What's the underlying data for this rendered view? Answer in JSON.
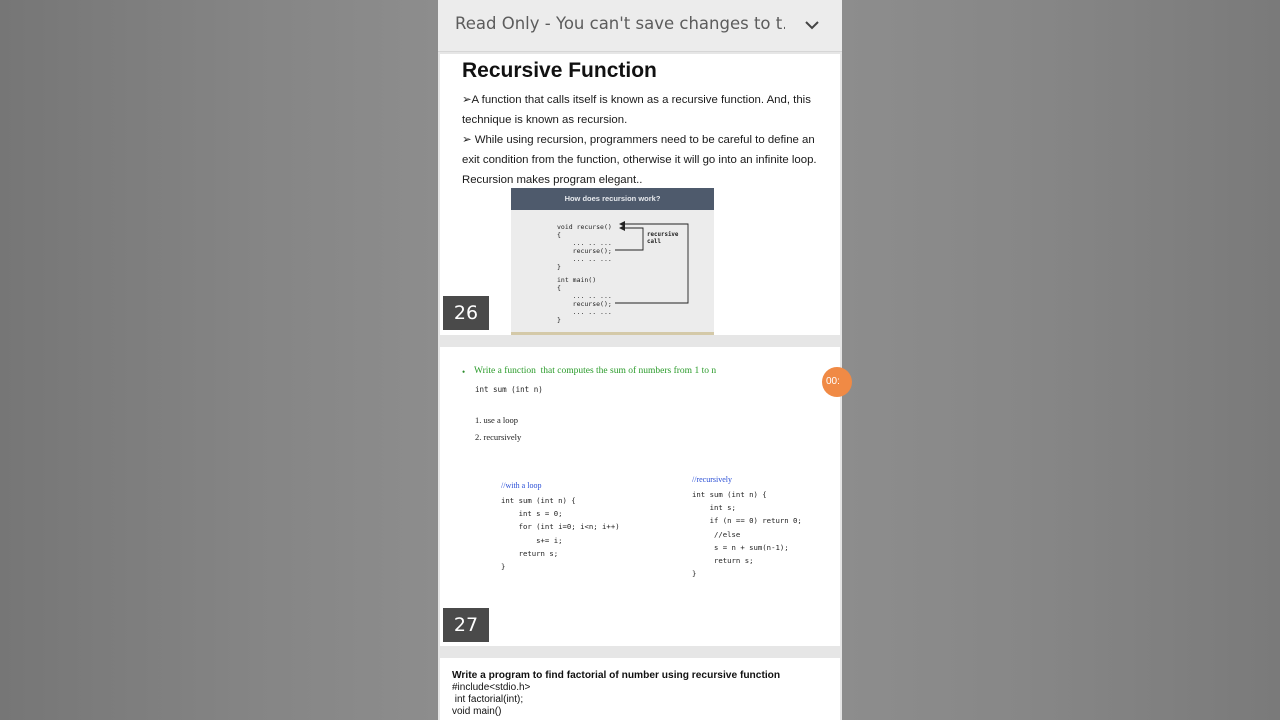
{
  "viewer": {
    "banner_text": "Read Only - You can't save changes to t...",
    "chevron_icon": "chevron-down-icon"
  },
  "slide26": {
    "number": "26",
    "title": "Recursive Function",
    "para1": "➢A function that calls itself is known as a recursive function. And, this technique is known as recursion.",
    "para2": "➢ While using recursion, programmers need to be careful to define an exit condition from the function, otherwise it will go into an infinite loop.",
    "para3": "Recursion makes program elegant..",
    "figure": {
      "heading": "How does recursion work?",
      "code_top": "void recurse()\n{\n    ... .. ...\n    recurse();\n    ... .. ...\n}",
      "code_bottom": "int main()\n{\n    ... .. ...\n    recurse();\n    ... .. ...\n}",
      "note": "recursive\ncall"
    }
  },
  "slide27": {
    "number": "27",
    "bullet": "•",
    "task": "Write a function  that computes the sum of numbers from 1 to n",
    "signature": "int sum (int n)",
    "option1": "1. use a loop",
    "option2": "2. recursively",
    "loop_comment": "//with a loop",
    "loop_code": "int sum (int n) {\n    int s = 0;\n    for (int i=0; i<n; i++)\n        s+= i;\n    return s;\n}",
    "rec_comment": "//recursively",
    "rec_code": "int sum (int n) {\n    int s;\n    if (n == 0) return 0;\n     //else\n     s = n + sum(n-1);\n     return s;\n}"
  },
  "slide28": {
    "title": "Write a program to find factorial of number using recursive function",
    "line1": "#include<stdio.h>",
    "line2": " int factorial(int);",
    "line3": "void main()"
  },
  "overlay": {
    "timer_text": "00:"
  }
}
